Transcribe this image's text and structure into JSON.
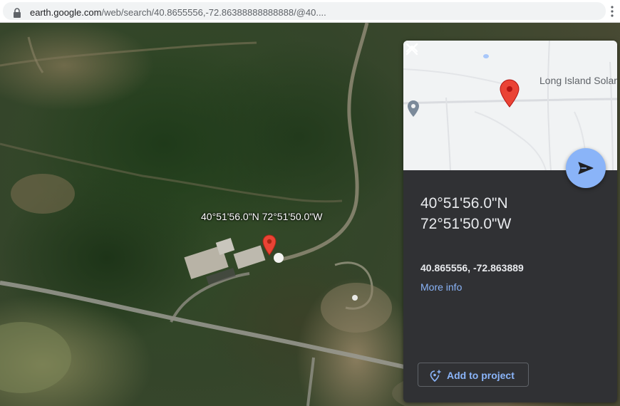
{
  "browser": {
    "url_host": "earth.google.com",
    "url_rest": "/web/search/40.8655556,-72.86388888888888/@40...."
  },
  "map": {
    "location_label": "40°51'56.0\"N 72°51'50.0\"W",
    "pin_color": "#ea4335"
  },
  "card": {
    "title_lat": "40°51'56.0\"N",
    "title_lon": "72°51'50.0\"W",
    "decimal_coords": "40.865556, -72.863889",
    "more_info": "More info",
    "add_to_project": "Add to project",
    "minimap_place_label": "Long Island Solar",
    "accent_color": "#8ab4f8",
    "background_color": "#303134"
  }
}
